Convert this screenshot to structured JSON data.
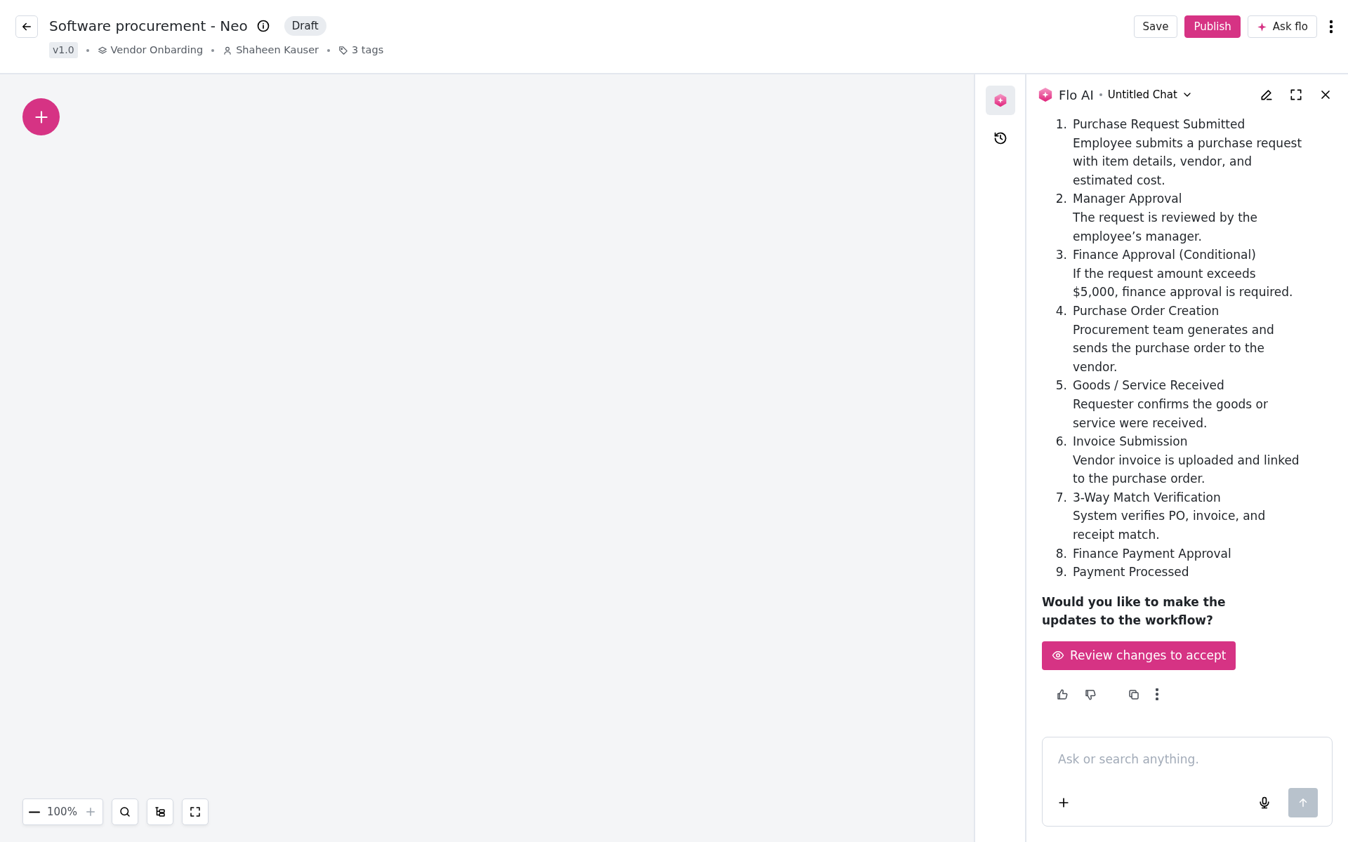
{
  "header": {
    "title": "Software procurement - Neo",
    "status": "Draft",
    "version": "v1.0",
    "meta": [
      {
        "kind": "category",
        "text": "Vendor Onbarding"
      },
      {
        "kind": "owner",
        "text": "Shaheen Kauser"
      },
      {
        "kind": "tags",
        "text": "3 tags"
      }
    ],
    "actions": [
      {
        "kind": "outline",
        "label": "Save"
      },
      {
        "kind": "primary",
        "label": "Publish"
      },
      {
        "kind": "ai",
        "label": "Ask flo"
      }
    ]
  },
  "zoom": {
    "value": "100%"
  },
  "side_rail": [
    {
      "kind": "ai",
      "selected": true
    },
    {
      "kind": "history",
      "selected": false
    }
  ],
  "chat": {
    "assistant": "Flo AI",
    "chat_title": "Untitled Chat",
    "steps": [
      {
        "number": "1.",
        "title": "Purchase Request Submitted",
        "detail": "Employee submits a purchase request with item details, vendor, and estimated cost."
      },
      {
        "number": "2.",
        "title": "Manager Approval",
        "detail": "The request is reviewed by the employee’s manager."
      },
      {
        "number": "3.",
        "title": "Finance Approval (Conditional)",
        "detail": "If the request amount exceeds $5,000, finance approval is required."
      },
      {
        "number": "4.",
        "title": "Purchase Order Creation",
        "detail": "Procurement team generates and sends the purchase order to the vendor."
      },
      {
        "number": "5.",
        "title": "Goods / Service Received",
        "detail": "Requester confirms the goods or service were received."
      },
      {
        "number": "6.",
        "title": "Invoice Submission",
        "detail": "Vendor invoice is uploaded and linked to the purchase order."
      },
      {
        "number": "7.",
        "title": "3-Way Match Verification",
        "detail": "System verifies PO, invoice, and receipt match."
      },
      {
        "number": "8.",
        "title": "Finance Payment Approval"
      },
      {
        "number": "9.",
        "title": "Payment Processed"
      }
    ],
    "question": "Would you like to make the updates to the workflow?",
    "action": "Review changes to accept",
    "input": {
      "placeholder": "Ask or search anything."
    }
  }
}
